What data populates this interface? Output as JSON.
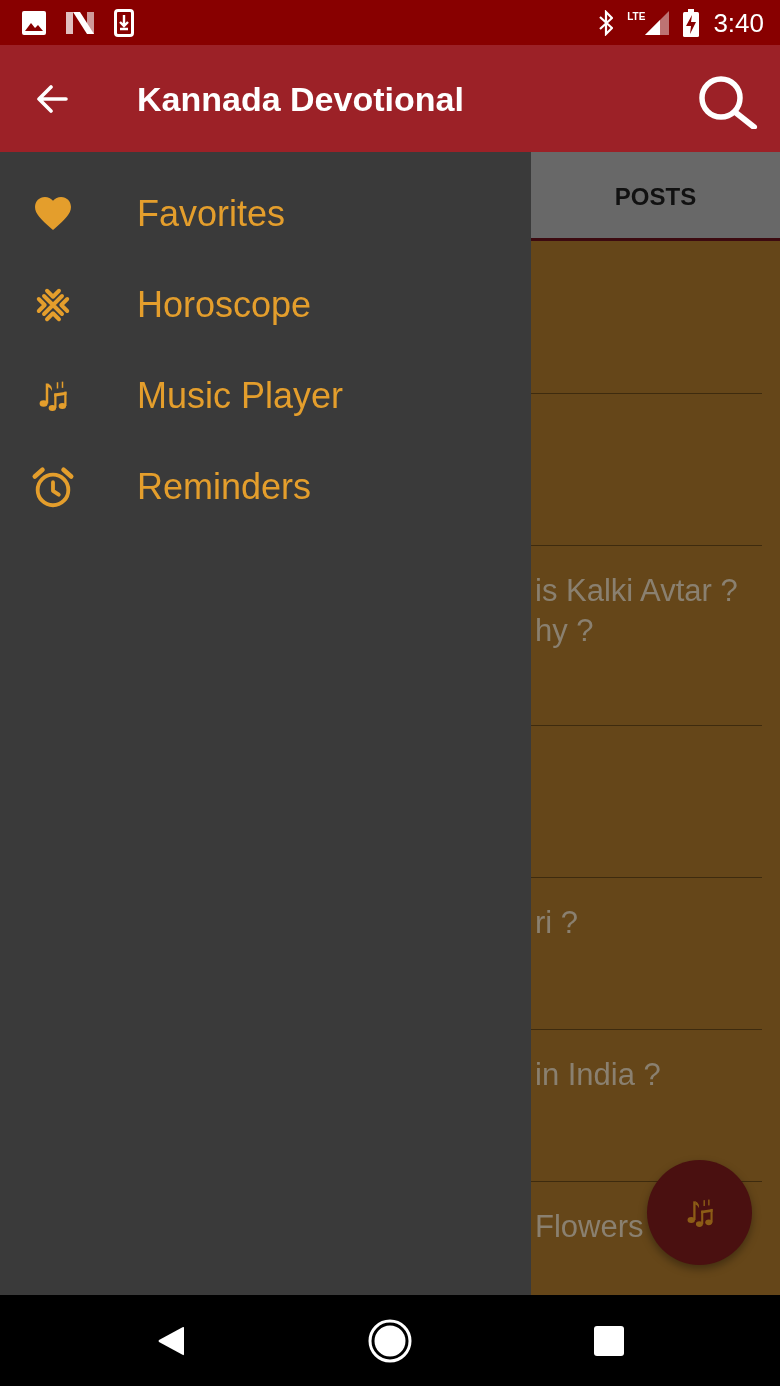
{
  "status_bar": {
    "network_label": "LTE",
    "time": "3:40"
  },
  "app_bar": {
    "title": "Kannada Devotional"
  },
  "drawer": {
    "items": [
      {
        "label": "Favorites",
        "selected": false
      },
      {
        "label": "Horoscope",
        "selected": false
      },
      {
        "label": "Music Player",
        "selected": false
      },
      {
        "label": "Reminders",
        "selected": false
      }
    ]
  },
  "tabs": [
    {
      "label": "POSTS",
      "selected": true
    }
  ],
  "posts": [
    {
      "kind": "covered"
    },
    {
      "kind": "covered"
    },
    {
      "kind": "text",
      "title_lines": [
        "is Kalki Avtar ?",
        "hy ?"
      ]
    },
    {
      "kind": "covered"
    },
    {
      "kind": "text",
      "title_lines": [
        "ri ?"
      ]
    },
    {
      "kind": "text",
      "title_lines": [
        "in India ?"
      ]
    },
    {
      "kind": "text",
      "title_lines": [
        "Flowers"
      ]
    }
  ]
}
